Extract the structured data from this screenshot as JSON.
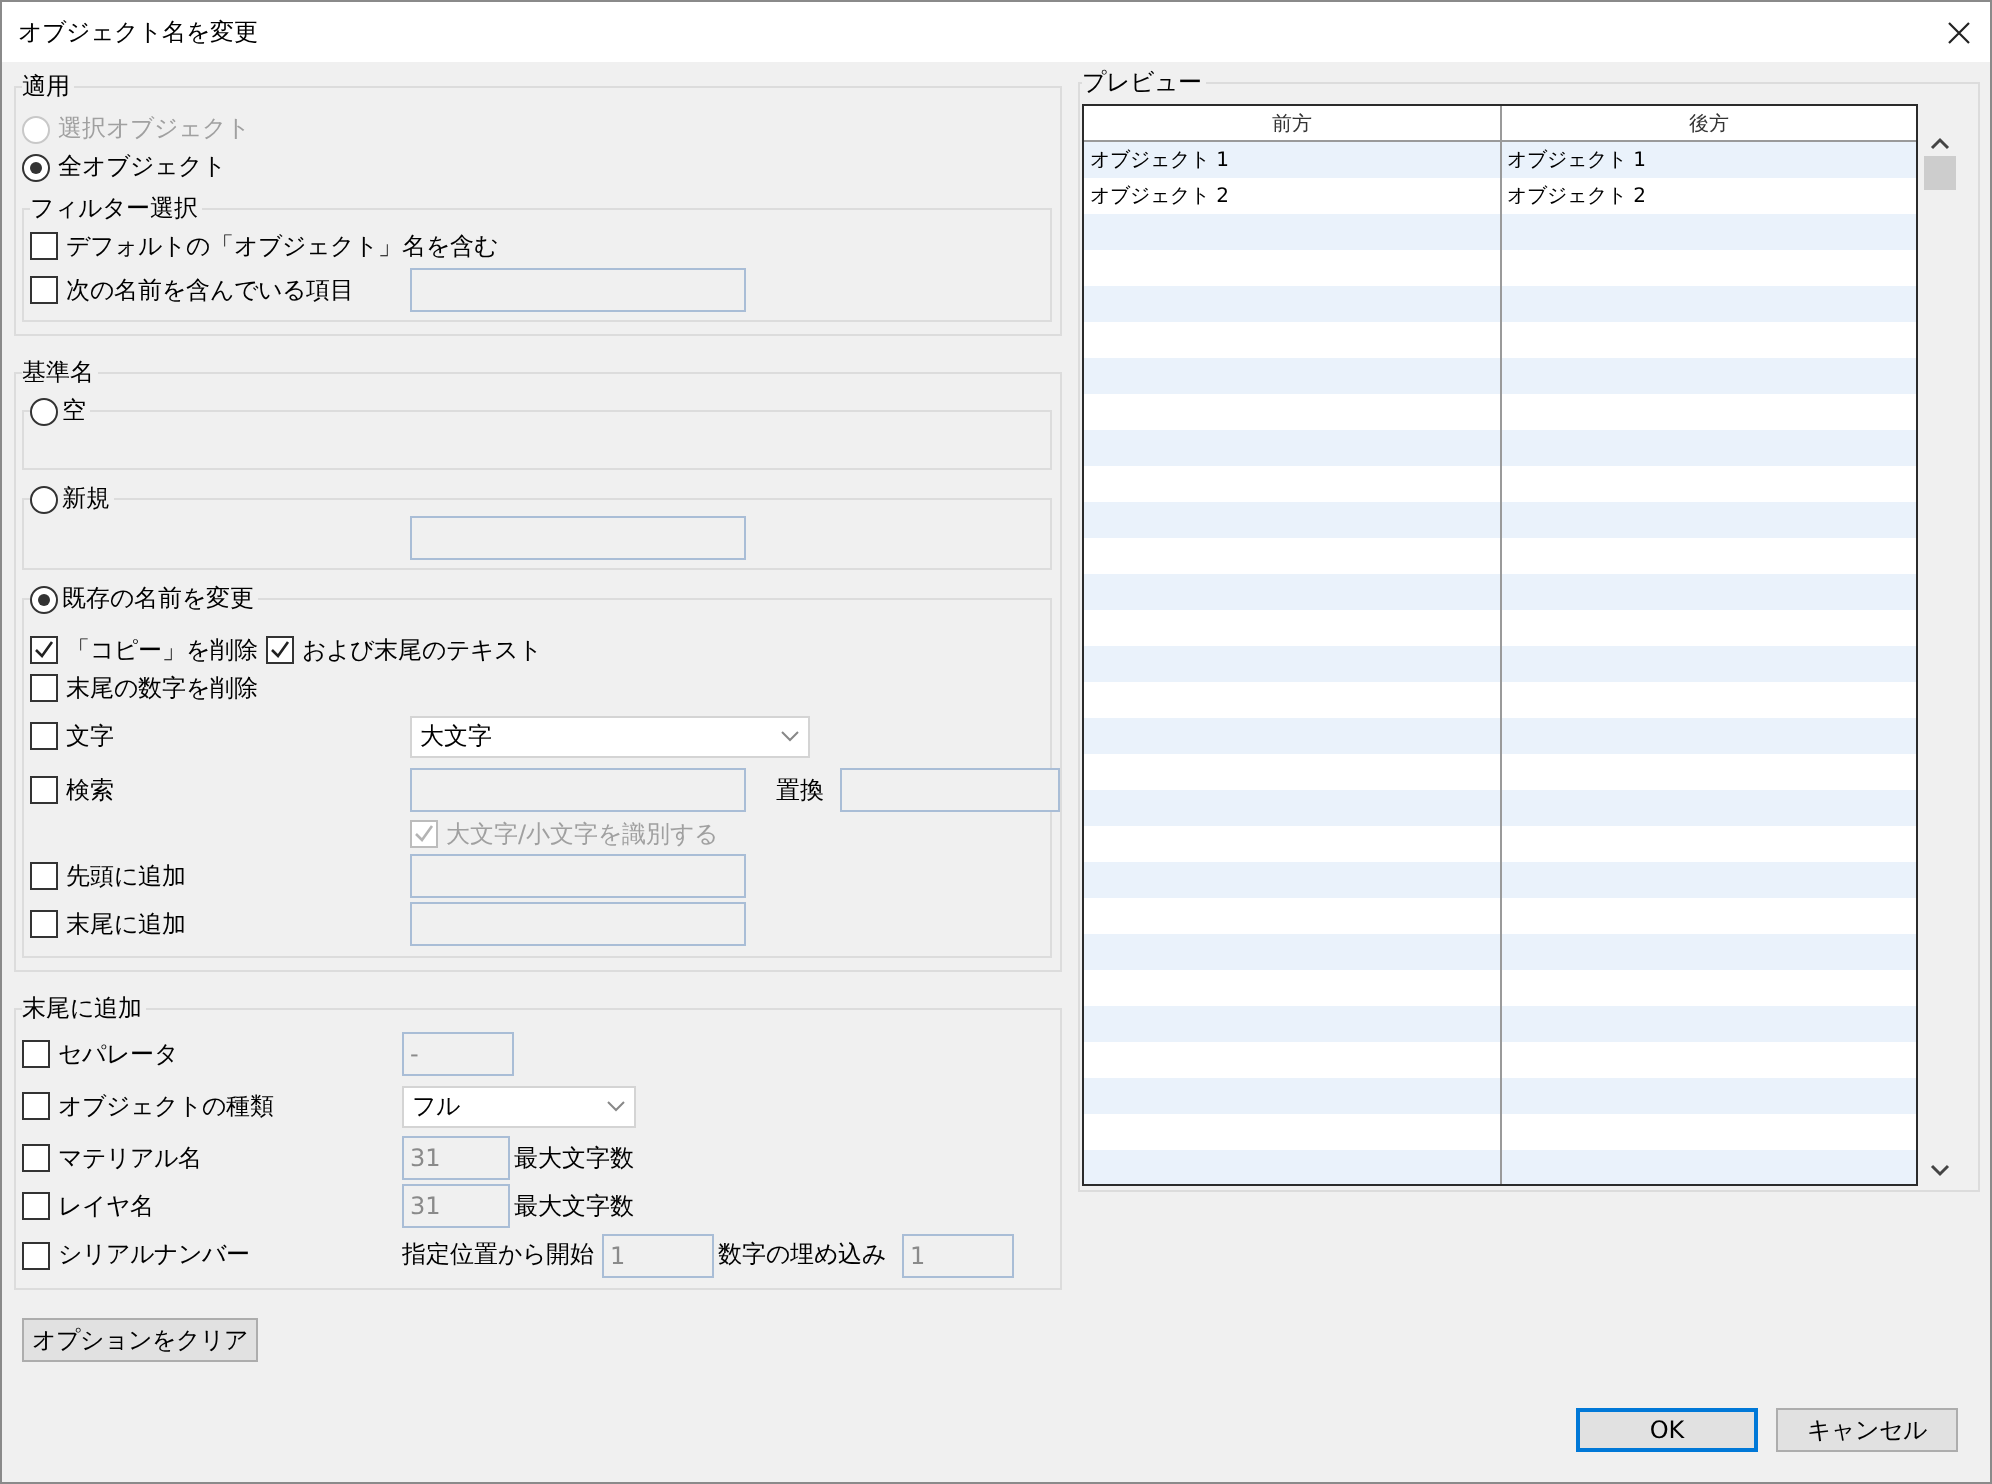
{
  "window": {
    "title": "オブジェクト名を変更"
  },
  "apply": {
    "title": "適用",
    "targets": [
      {
        "label": "選択オブジェクト",
        "selected": false,
        "disabled": true
      },
      {
        "label": "全オブジェクト",
        "selected": true,
        "disabled": false
      }
    ],
    "filter": {
      "title": "フィルター選択",
      "rows": [
        {
          "kind": "check",
          "label": "デフォルトの「オブジェクト」名を含む",
          "checked": false
        },
        {
          "kind": "field",
          "label": "次の名前を含んでいる項目",
          "checked": false
        }
      ]
    }
  },
  "base_name": {
    "title": "基準名",
    "modes": [
      {
        "kind": "empty",
        "label": "空",
        "selected": false
      },
      {
        "kind": "new",
        "label": "新規",
        "selected": false
      },
      {
        "kind": "existing",
        "label": "既存の名前を変更",
        "selected": true,
        "rows": [
          {
            "kind": "pair",
            "items": [
              {
                "label": "「コピー」を削除",
                "checked": true
              },
              {
                "label": "および末尾のテキスト",
                "checked": true
              }
            ]
          },
          {
            "kind": "check",
            "label": "末尾の数字を削除",
            "checked": false
          },
          {
            "kind": "dropdown",
            "label": "文字",
            "checked": false,
            "value": "大文字"
          },
          {
            "kind": "search",
            "label": "検索",
            "checked": false,
            "replace_label": "置換",
            "case": {
              "label": "大文字/小文字を識別する",
              "checked": true,
              "disabled": true
            }
          },
          {
            "kind": "field",
            "label": "先頭に追加",
            "checked": false
          },
          {
            "kind": "field",
            "label": "末尾に追加",
            "checked": false
          }
        ]
      }
    ]
  },
  "suffix": {
    "title": "末尾に追加",
    "rows": [
      {
        "kind": "short_field",
        "label": "セパレータ",
        "checked": false,
        "value": "-"
      },
      {
        "kind": "dropdown",
        "label": "オブジェクトの種類",
        "checked": false,
        "value": "フル"
      },
      {
        "kind": "max_field",
        "label": "マテリアル名",
        "checked": false,
        "value": "31",
        "unit": "最大文字数"
      },
      {
        "kind": "max_field",
        "label": "レイヤ名",
        "checked": false,
        "value": "31",
        "unit": "最大文字数"
      },
      {
        "kind": "serial",
        "label": "シリアルナンバー",
        "checked": false,
        "start_label": "指定位置から開始",
        "start": "1",
        "pad_label": "数字の埋め込み",
        "pad": "1"
      }
    ]
  },
  "clear_button": "オプションをクリア",
  "preview": {
    "title": "プレビュー",
    "columns": [
      "前方",
      "後方"
    ],
    "rows": [
      [
        "オブジェクト 1",
        "オブジェクト 1"
      ],
      [
        "オブジェクト 2",
        "オブジェクト 2"
      ]
    ]
  },
  "buttons": [
    {
      "label": "OK",
      "default": true
    },
    {
      "label": "キャンセル",
      "default": false
    }
  ]
}
